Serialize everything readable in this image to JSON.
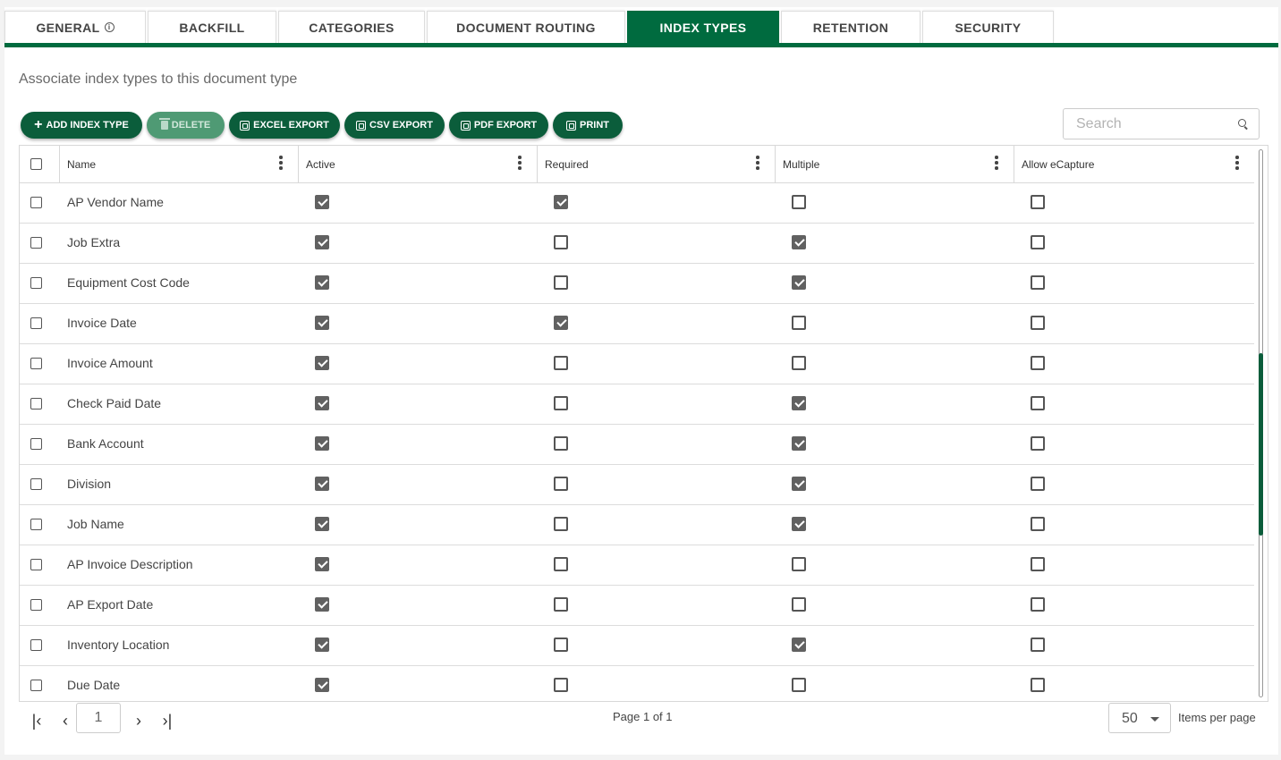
{
  "tabs": [
    {
      "label": "GENERAL",
      "has_info_icon": true
    },
    {
      "label": "BACKFILL"
    },
    {
      "label": "CATEGORIES"
    },
    {
      "label": "DOCUMENT ROUTING"
    },
    {
      "label": "INDEX TYPES",
      "active": true
    },
    {
      "label": "RETENTION"
    },
    {
      "label": "SECURITY"
    }
  ],
  "subtitle": "Associate index types to this document type",
  "toolbar": {
    "add": "ADD INDEX TYPE",
    "delete": "DELETE",
    "excel": "EXCEL EXPORT",
    "csv": "CSV EXPORT",
    "pdf": "PDF EXPORT",
    "print": "PRINT"
  },
  "search": {
    "placeholder": "Search",
    "value": ""
  },
  "grid": {
    "columns": [
      "Name",
      "Active",
      "Required",
      "Multiple",
      "Allow eCapture"
    ],
    "rows": [
      {
        "name": "AP Vendor Name",
        "active": true,
        "required": true,
        "multiple": false,
        "ecapture": false
      },
      {
        "name": "Job Extra",
        "active": true,
        "required": false,
        "multiple": true,
        "ecapture": false
      },
      {
        "name": "Equipment Cost Code",
        "active": true,
        "required": false,
        "multiple": true,
        "ecapture": false
      },
      {
        "name": "Invoice Date",
        "active": true,
        "required": true,
        "multiple": false,
        "ecapture": false
      },
      {
        "name": "Invoice Amount",
        "active": true,
        "required": false,
        "multiple": false,
        "ecapture": false
      },
      {
        "name": "Check Paid Date",
        "active": true,
        "required": false,
        "multiple": true,
        "ecapture": false
      },
      {
        "name": "Bank Account",
        "active": true,
        "required": false,
        "multiple": true,
        "ecapture": false
      },
      {
        "name": "Division",
        "active": true,
        "required": false,
        "multiple": true,
        "ecapture": false
      },
      {
        "name": "Job Name",
        "active": true,
        "required": false,
        "multiple": true,
        "ecapture": false
      },
      {
        "name": "AP Invoice Description",
        "active": true,
        "required": false,
        "multiple": false,
        "ecapture": false
      },
      {
        "name": "AP Export Date",
        "active": true,
        "required": false,
        "multiple": false,
        "ecapture": false
      },
      {
        "name": "Inventory Location",
        "active": true,
        "required": false,
        "multiple": true,
        "ecapture": false
      },
      {
        "name": "Due Date",
        "active": true,
        "required": false,
        "multiple": false,
        "ecapture": false
      }
    ]
  },
  "pager": {
    "page_value": "1",
    "page_info": "Page 1 of 1",
    "items_per_page": "50",
    "items_per_page_label": "Items per page"
  },
  "colors": {
    "brand_green": "#006b3f",
    "button_green": "#0b5d3b"
  }
}
